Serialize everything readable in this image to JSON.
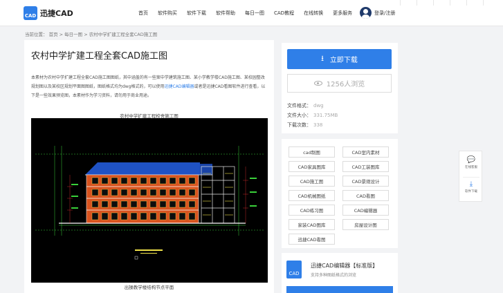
{
  "header": {
    "logo_glyph": "CAD",
    "logo_text": "迅捷CAD",
    "nav": [
      "首页",
      "软件购买",
      "软件下载",
      "软件帮助",
      "每日一图",
      "CAD教程",
      "在线转换",
      "更多服务"
    ],
    "user_label": "登录/注册"
  },
  "breadcrumb": "当前位置： 首页 > 每日一图 > 农村中学扩建工程全套CAD施工图",
  "article": {
    "title": "农村中学扩建工程全套CAD施工图",
    "desc_1": "本素材为农村中学扩建工程全套CAD施工图图纸，其中涵盖的有一些案中学建筑施工图、某小学教学楼CAD施工图、某校园整改规划图以及某校区规划平面图图纸，图纸格式均为dwg格式的，可以使用",
    "desc_link": "迅捷CAD编辑器",
    "desc_2": "或者是迅捷CAD看图软件进行查看，以下是一些效果预览图，本素材作为学习资料，请勿用于商业用途。",
    "caption": "农村中学扩建工程校舍施工图",
    "caption2": "出操教学楼结构节点平面"
  },
  "download": {
    "button_label": "立即下载",
    "views": "1256人浏览",
    "format_label": "文件格式：",
    "format_value": "dwg",
    "size_label": "文件大小：",
    "size_value": "331.75MB",
    "count_label": "下载次数：",
    "count_value": "338"
  },
  "tags": [
    "cad制图",
    "CAD室内素材",
    "CAD家具图库",
    "CAD工装图库",
    "CAD施工图",
    "CAD景观设计",
    "CAD机械图纸",
    "CAD看图",
    "CAD练习图",
    "CAD编辑器",
    "家装CAD图库",
    "房屋设计图",
    "迅捷CAD看图"
  ],
  "promo": {
    "logo_glyph": "CAD",
    "title": "迅捷CAD编辑器【标准版】",
    "subtitle": "支持多种图纸格式的浏览"
  },
  "float": {
    "feedback": "在线客服",
    "download": "软件下载"
  },
  "colors": {
    "accent": "#2f7fe8",
    "cad_background": "#000000"
  },
  "icons": [
    "logo-icon",
    "avatar-icon",
    "download-arrow-icon",
    "eye-icon",
    "chat-icon",
    "download-icon"
  ]
}
